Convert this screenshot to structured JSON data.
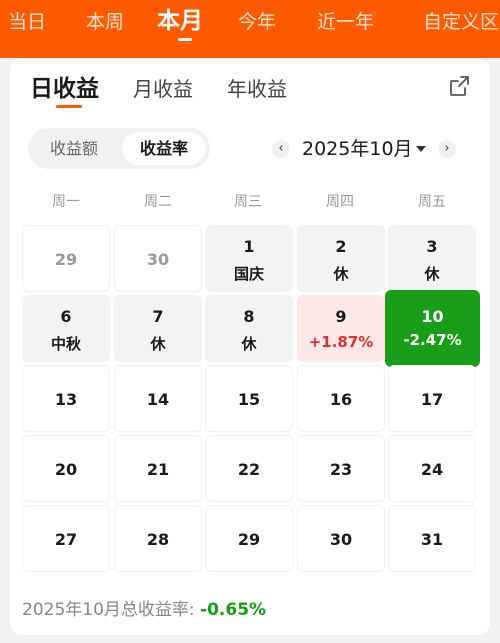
{
  "period_tabs": [
    "当日",
    "本周",
    "本月",
    "今年",
    "近一年",
    "自定义区"
  ],
  "active_period_index": 2,
  "earnings_tabs": [
    "日收益",
    "月收益",
    "年收益"
  ],
  "active_earnings_index": 0,
  "toggle": {
    "amount_label": "收益额",
    "rate_label": "收益率",
    "active": "rate"
  },
  "month_nav": {
    "prev_icon": "‹",
    "current": "2025年10月",
    "next_icon": "›"
  },
  "weekdays": [
    "周一",
    "周二",
    "周三",
    "周四",
    "周五"
  ],
  "calendar": [
    [
      {
        "day": "29",
        "kind": "other-month"
      },
      {
        "day": "30",
        "kind": "other-month"
      },
      {
        "day": "1",
        "label": "国庆",
        "kind": "holiday"
      },
      {
        "day": "2",
        "label": "休",
        "kind": "holiday"
      },
      {
        "day": "3",
        "label": "休",
        "kind": "holiday"
      }
    ],
    [
      {
        "day": "6",
        "label": "中秋",
        "kind": "holiday"
      },
      {
        "day": "7",
        "label": "休",
        "kind": "holiday"
      },
      {
        "day": "8",
        "label": "休",
        "kind": "holiday"
      },
      {
        "day": "9",
        "label": "+1.87%",
        "kind": "gain"
      },
      {
        "day": "10",
        "label": "-2.47%",
        "kind": "loss"
      }
    ],
    [
      {
        "day": "13"
      },
      {
        "day": "14"
      },
      {
        "day": "15"
      },
      {
        "day": "16"
      },
      {
        "day": "17"
      }
    ],
    [
      {
        "day": "20"
      },
      {
        "day": "21"
      },
      {
        "day": "22"
      },
      {
        "day": "23"
      },
      {
        "day": "24"
      }
    ],
    [
      {
        "day": "27"
      },
      {
        "day": "28"
      },
      {
        "day": "29"
      },
      {
        "day": "30"
      },
      {
        "day": "31"
      }
    ]
  ],
  "summary": {
    "label": "2025年10月总收益率:",
    "value": "-0.65%"
  },
  "colors": {
    "brand": "#ff5a00",
    "gain": "#e0312c",
    "loss": "#1a9e1a"
  },
  "icons": {
    "share": "share-icon",
    "month_dropdown": "caret-down-icon"
  }
}
